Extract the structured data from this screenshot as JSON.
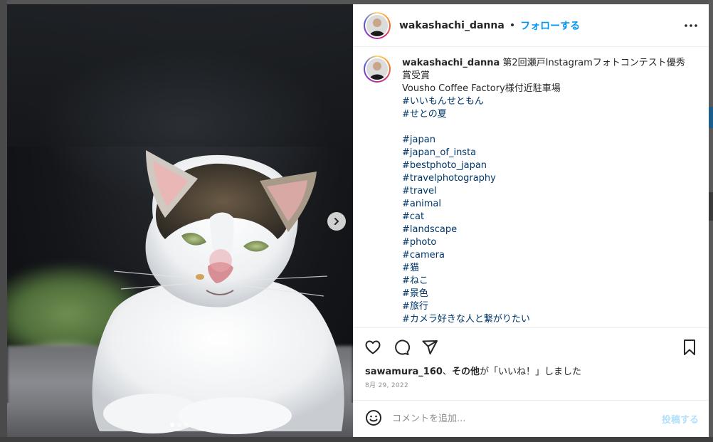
{
  "post": {
    "username": "wakashachi_danna",
    "separator": "•",
    "follow_label": "フォローする",
    "more_label": "その他"
  },
  "caption": {
    "username": "wakashachi_danna",
    "title": "第2回瀬戸Instagramフォトコンテスト優秀賞受賞",
    "location": "Vousho Coffee Factory様付近駐車場",
    "tags_jp1": [
      "#いいもんせともん",
      "#せとの夏"
    ],
    "tags": [
      "#japan",
      "#japan_of_insta",
      "#bestphoto_japan",
      "#travelphotography",
      "#travel",
      "#animal",
      "#cat",
      "#landscape",
      "#photo",
      "#camera",
      "#猫",
      "#ねこ",
      "#景色",
      "#旅行",
      "#カメラ好きな人と繋がりたい"
    ]
  },
  "likes": {
    "user": "sawamura_160",
    "joiner": "、",
    "others": "その他",
    "suffix": "が「いいね！」しました"
  },
  "date": "8月 29, 2022",
  "comment": {
    "placeholder": "コメントを追加...",
    "post_label": "投稿する"
  },
  "carousel": {
    "slides": 3,
    "active": 1
  },
  "icons": {
    "next": "chevron-right-icon",
    "more": "more-horizontal-icon",
    "like": "heart-icon",
    "comment": "comment-icon",
    "share": "paper-plane-icon",
    "save": "bookmark-icon",
    "emoji": "emoji-icon"
  },
  "colors": {
    "link_blue": "#0095f6",
    "hashtag": "#00376b",
    "post_disabled": "#b2dffc"
  }
}
